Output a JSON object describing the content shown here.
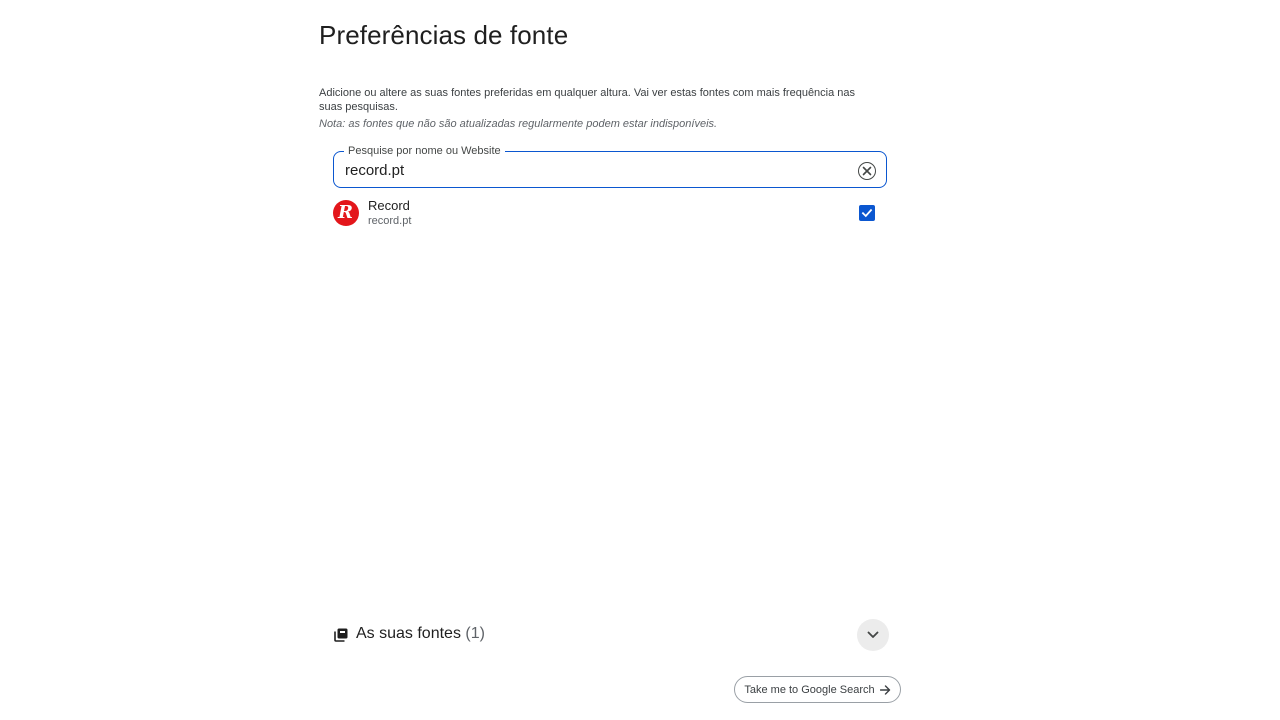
{
  "page": {
    "title": "Preferências de fonte",
    "description": "Adicione ou altere as suas fontes preferidas em qualquer altura. Vai ver estas fontes com mais frequência nas suas pesquisas.",
    "note": "Nota: as fontes que não são atualizadas regularmente podem estar indisponíveis."
  },
  "search": {
    "label": "Pesquise por nome ou Website",
    "value": "record.pt",
    "clear_icon": "clear-circle-icon"
  },
  "results": [
    {
      "name": "Record",
      "domain": "record.pt",
      "logo_letter": "R",
      "logo_color": "#e3161b",
      "checked": true
    }
  ],
  "your_sources": {
    "label": "As suas fontes",
    "count": "(1)",
    "icon": "sources-stack-icon",
    "expand_icon": "chevron-down-icon"
  },
  "footer": {
    "google_button_label": "Take me to Google Search",
    "arrow_icon": "arrow-right-icon"
  },
  "colors": {
    "accent": "#0b57d0",
    "text": "#1f1f1f",
    "muted": "#5f6368"
  }
}
